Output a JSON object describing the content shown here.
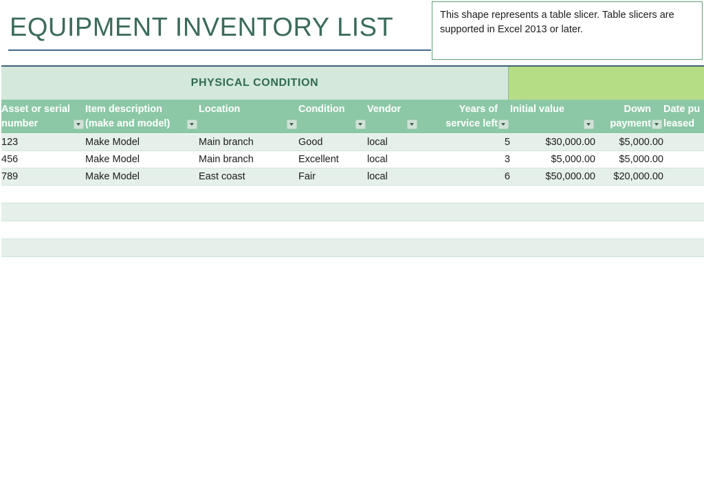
{
  "page": {
    "title": "EQUIPMENT INVENTORY LIST"
  },
  "callout": {
    "text": "This shape represents a table slicer. Table slicers are supported in Excel 2013 or later."
  },
  "slicer": {
    "title": "PHYSICAL CONDITION",
    "pane_color": "#d4e8dc",
    "fill_color": "#b5dd85"
  },
  "table": {
    "header_color": "#8cc8a6",
    "band_color": "#e6f0ea",
    "columns": [
      {
        "line1": "Asset or serial",
        "line2": "number",
        "align": "left",
        "filter": true
      },
      {
        "line1": "Item description",
        "line2": "(make and model)",
        "align": "left",
        "filter": true
      },
      {
        "line1": "",
        "line2": "Location",
        "align": "left",
        "filter": true
      },
      {
        "line1": "",
        "line2": "Condition",
        "align": "left",
        "filter": true
      },
      {
        "line1": "",
        "line2": "Vendor",
        "align": "left",
        "filter": true
      },
      {
        "line1": "Years of",
        "line2": "service left",
        "align": "right",
        "filter": true
      },
      {
        "line1": "",
        "line2": "Initial value",
        "align": "left",
        "filter": true
      },
      {
        "line1": "Down",
        "line2": "payment",
        "align": "right",
        "filter": true
      },
      {
        "line1": "Date pu",
        "line2": "leased",
        "align": "left",
        "filter": true
      }
    ],
    "rows": [
      {
        "asset": "123",
        "description": "Make Model",
        "location": "Main branch",
        "condition": "Good",
        "vendor": "local",
        "years_left": "5",
        "initial_value": "$30,000.00",
        "down_payment": "$5,000.00",
        "date": ""
      },
      {
        "asset": "456",
        "description": "Make Model",
        "location": "Main branch",
        "condition": "Excellent",
        "vendor": "local",
        "years_left": "3",
        "initial_value": "$5,000.00",
        "down_payment": "$5,000.00",
        "date": ""
      },
      {
        "asset": "789",
        "description": "Make Model",
        "location": "East coast",
        "condition": "Fair",
        "vendor": "local",
        "years_left": "6",
        "initial_value": "$50,000.00",
        "down_payment": "$20,000.00",
        "date": ""
      }
    ],
    "empty_row_count": 4
  }
}
